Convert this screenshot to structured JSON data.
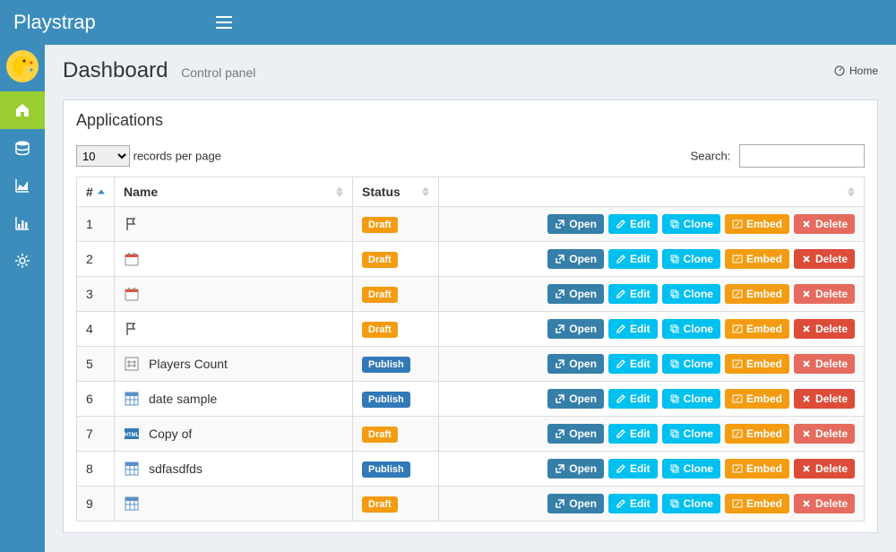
{
  "brand": "Playstrap",
  "header": {
    "title": "Dashboard",
    "subtitle": "Control panel"
  },
  "breadcrumb": {
    "home": "Home"
  },
  "panel": {
    "title": "Applications"
  },
  "table": {
    "records_select": "10",
    "records_per_page": "records per page",
    "search_label": "Search:",
    "columns": {
      "idx": "#",
      "name": "Name",
      "status": "Status"
    },
    "rows": [
      {
        "idx": "1",
        "name": "",
        "icon": "flag",
        "status": "Draft"
      },
      {
        "idx": "2",
        "name": "",
        "icon": "calendar",
        "status": "Draft"
      },
      {
        "idx": "3",
        "name": "",
        "icon": "calendar",
        "status": "Draft"
      },
      {
        "idx": "4",
        "name": "",
        "icon": "flag",
        "status": "Draft"
      },
      {
        "idx": "5",
        "name": "Players Count",
        "icon": "hash",
        "status": "Publish"
      },
      {
        "idx": "6",
        "name": "date sample",
        "icon": "grid",
        "status": "Publish"
      },
      {
        "idx": "7",
        "name": "Copy of",
        "icon": "html",
        "status": "Draft"
      },
      {
        "idx": "8",
        "name": "sdfasdfds",
        "icon": "grid",
        "status": "Publish"
      },
      {
        "idx": "9",
        "name": "",
        "icon": "grid",
        "status": "Draft"
      }
    ]
  },
  "actions": {
    "open": "Open",
    "edit": "Edit",
    "clone": "Clone",
    "embed": "Embed",
    "delete": "Delete"
  }
}
